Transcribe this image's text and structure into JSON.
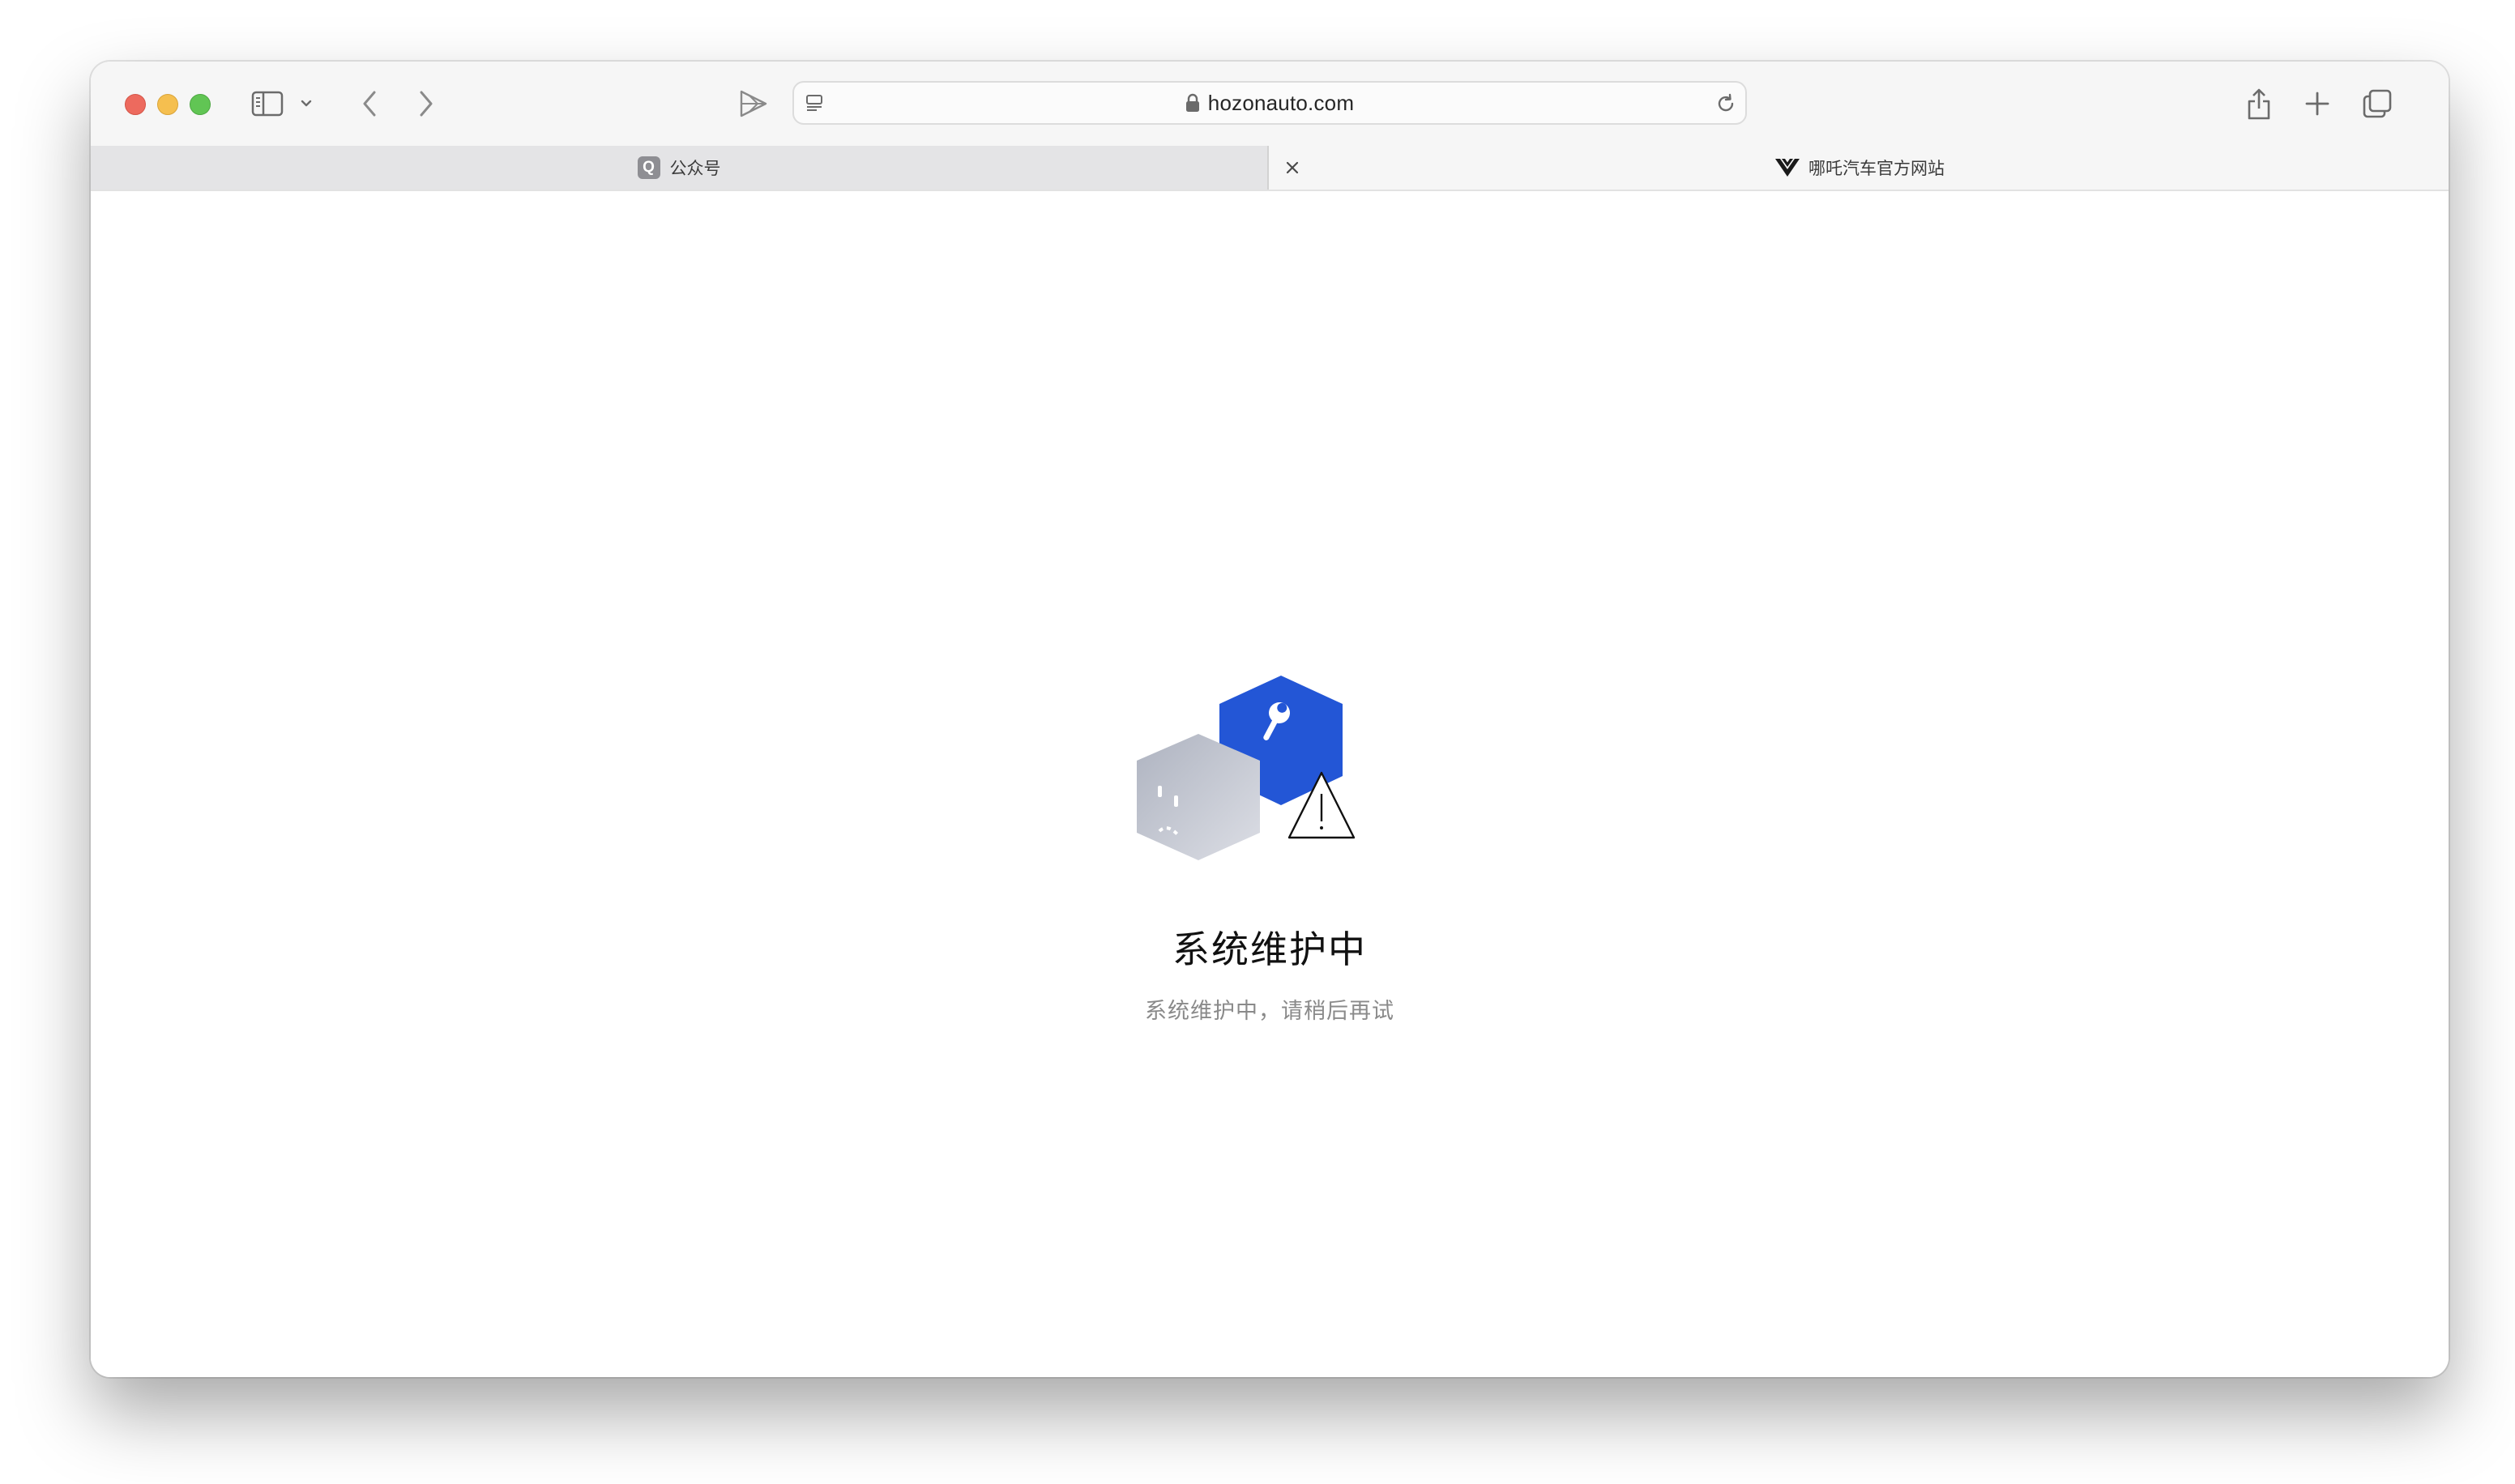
{
  "browser": {
    "address_url": "hozonauto.com",
    "tabs": [
      {
        "label": "公众号",
        "favicon": "q-favicon",
        "favicon_letter": "Q",
        "active": false
      },
      {
        "label": "哪吒汽车官方网站",
        "favicon": "hozon-logo-icon",
        "active": true
      }
    ],
    "toolbar_icons": [
      "sidebar-icon",
      "chevron-down-icon",
      "back-icon",
      "forward-icon",
      "extension-icon",
      "reader-icon",
      "lock-icon",
      "reload-icon",
      "share-icon",
      "plus-icon",
      "tabs-overview-icon"
    ],
    "traffic_lights": {
      "close": "#ed6a5e",
      "minimize": "#f5bf4f",
      "zoom": "#61c554"
    }
  },
  "page": {
    "title": "系统维护中",
    "subtitle": "系统维护中，请稍后再试",
    "illustration": "maintenance-illustration",
    "colors": {
      "accent": "#2356d6",
      "cube_grey": "#c4c8d2",
      "subtitle": "#8a8a8a"
    }
  }
}
